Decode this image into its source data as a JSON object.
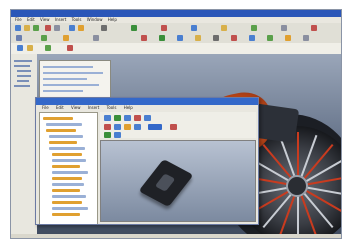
{
  "app": {
    "title": "",
    "menu": [
      "File",
      "Edit",
      "View",
      "Insert",
      "Tools",
      "Window",
      "Help"
    ]
  },
  "dialog": {
    "menu": [
      "File",
      "Edit",
      "View",
      "Insert",
      "Tools",
      "Help"
    ]
  },
  "colors": {
    "title_bar": "#2a56b8",
    "viewport_top": "#9aa6b9",
    "viewport_bottom": "#3e4a5e",
    "accent_orange": "#e0561c",
    "accent_red": "#c93b1f"
  },
  "icons": [
    "app-icon",
    "toolbar-icon",
    "wheel-model",
    "engine-model",
    "part-model"
  ]
}
